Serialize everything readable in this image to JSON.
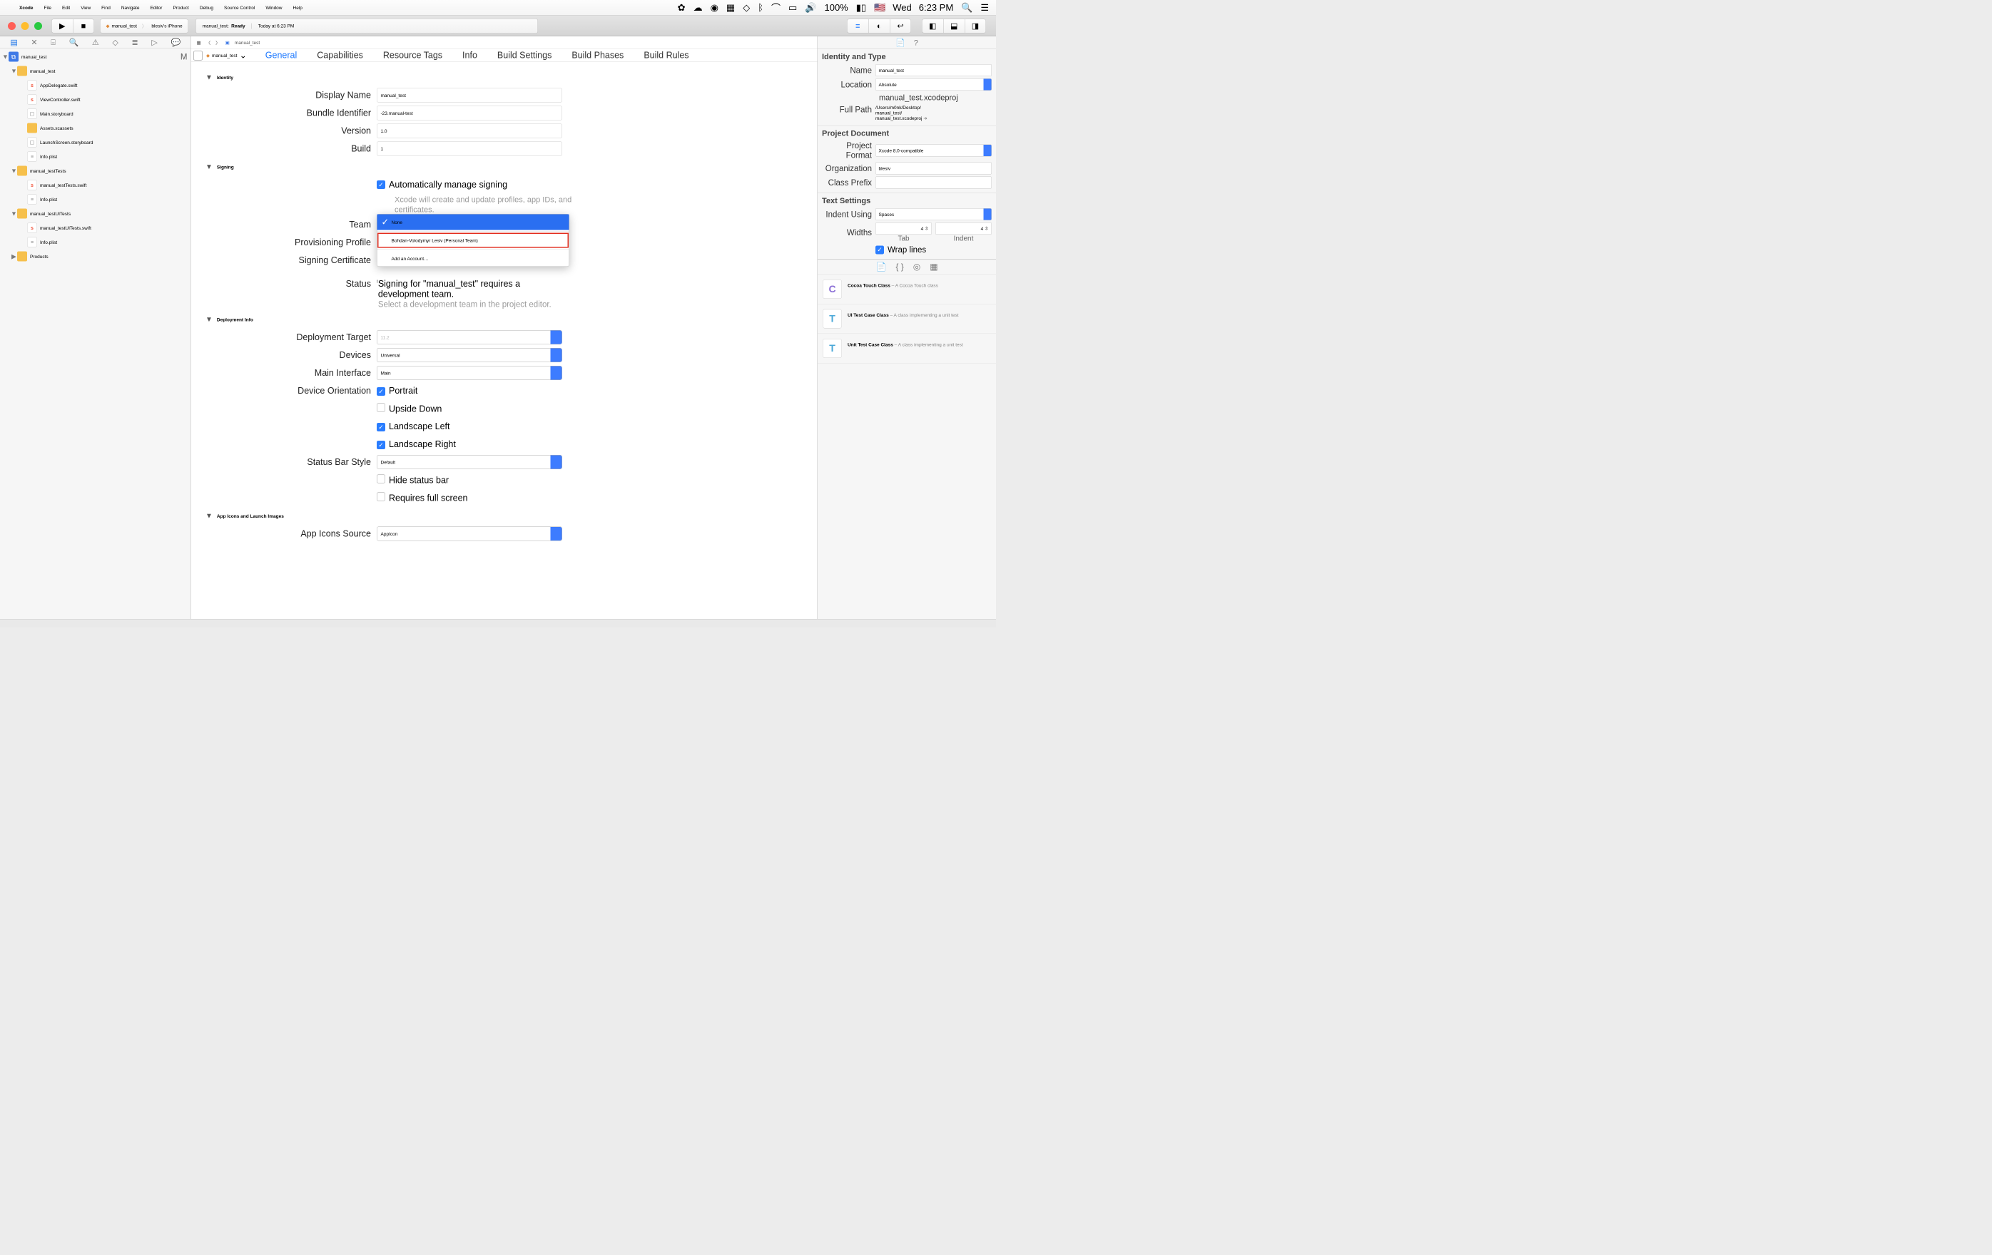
{
  "menubar": {
    "app": "Xcode",
    "items": [
      "File",
      "Edit",
      "View",
      "Find",
      "Navigate",
      "Editor",
      "Product",
      "Debug",
      "Source Control",
      "Window",
      "Help"
    ],
    "battery": "100%",
    "clock_day": "Wed",
    "clock_time": "6:23 PM"
  },
  "toolbar": {
    "scheme_target": "manual_test",
    "scheme_device": "blesiv's iPhone",
    "activity_proj": "manual_test:",
    "activity_state": "Ready",
    "activity_time": "Today at 6:23 PM"
  },
  "navigator": {
    "root": "manual_test",
    "root_status": "M",
    "g1": "manual_test",
    "g1_items": [
      "AppDelegate.swift",
      "ViewController.swift",
      "Main.storyboard",
      "Assets.xcassets",
      "LaunchScreen.storyboard",
      "Info.plist"
    ],
    "g2": "manual_testTests",
    "g2_items": [
      "manual_testTests.swift",
      "Info.plist"
    ],
    "g3": "manual_testUITests",
    "g3_items": [
      "manual_testUITests.swift",
      "Info.plist"
    ],
    "g4": "Products"
  },
  "jumpbar": {
    "item": "manual_test"
  },
  "target_popup": "manual_test",
  "tabs": [
    "General",
    "Capabilities",
    "Resource Tags",
    "Info",
    "Build Settings",
    "Build Phases",
    "Build Rules"
  ],
  "identity": {
    "title": "Identity",
    "display_name_label": "Display Name",
    "display_name_ph": "manual_test",
    "bundle_label": "Bundle Identifier",
    "bundle_val": "-23.manual-test",
    "version_label": "Version",
    "version_val": "1.0",
    "build_label": "Build",
    "build_val": "1"
  },
  "signing": {
    "title": "Signing",
    "auto_label": "Automatically manage signing",
    "auto_sub": "Xcode will create and update profiles, app IDs, and certificates.",
    "team_label": "Team",
    "prov_label": "Provisioning Profile",
    "cert_label": "Signing Certificate",
    "status_label": "Status",
    "status_msg": "Signing for \"manual_test\" requires a development team.",
    "status_sub": "Select a development team in the project editor.",
    "popup_none": "None",
    "popup_item": "Bohdan-Volodymyr Lesiv (Personal Team)",
    "popup_add": "Add an Account…"
  },
  "deploy": {
    "title": "Deployment Info",
    "target_label": "Deployment Target",
    "target_ph": "11.2",
    "devices_label": "Devices",
    "devices_val": "Universal",
    "main_if_label": "Main Interface",
    "main_if_val": "Main",
    "orient_label": "Device Orientation",
    "o_portrait": "Portrait",
    "o_upside": "Upside Down",
    "o_ll": "Landscape Left",
    "o_lr": "Landscape Right",
    "sbs_label": "Status Bar Style",
    "sbs_val": "Default",
    "hide_sb": "Hide status bar",
    "req_fs": "Requires full screen"
  },
  "icons": {
    "title": "App Icons and Launch Images",
    "aisrc_label": "App Icons Source",
    "aisrc_val": "AppIcon"
  },
  "insp": {
    "h_identity": "Identity and Type",
    "name_label": "Name",
    "name_val": "manual_test",
    "loc_label": "Location",
    "loc_val": "Absolute",
    "loc_file": "manual_test.xcodeproj",
    "fp_label": "Full Path",
    "fp_val1": "/Users/m0nk/Desktop/",
    "fp_val2": "manual_test/",
    "fp_val3": "manual_test.xcodeproj",
    "h_pdoc": "Project Document",
    "pf_label": "Project Format",
    "pf_val": "Xcode 8.0-compatible",
    "org_label": "Organization",
    "org_val": "blesiv",
    "cp_label": "Class Prefix",
    "cp_val": "",
    "h_ts": "Text Settings",
    "indent_label": "Indent Using",
    "indent_val": "Spaces",
    "widths_label": "Widths",
    "tab_val": "4",
    "indent_n_val": "4",
    "tab_lbl": "Tab",
    "indent_lbl": "Indent",
    "wrap": "Wrap lines"
  },
  "library": {
    "i1_t": "Cocoa Touch Class",
    "i1_d": " – A Cocoa Touch class",
    "i2_t": "UI Test Case Class",
    "i2_d": " – A class implementing a unit test",
    "i3_t": "Unit Test Case Class",
    "i3_d": " – A class implementing a unit test"
  }
}
